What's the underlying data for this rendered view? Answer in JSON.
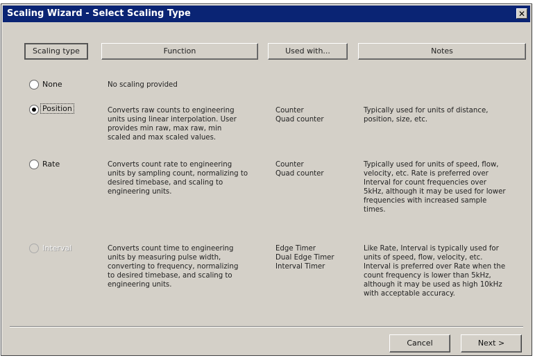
{
  "window": {
    "title": "Scaling Wizard - Select Scaling Type"
  },
  "headers": {
    "scaling_type": "Scaling type",
    "function": "Function",
    "used_with": "Used with...",
    "notes": "Notes"
  },
  "rows": [
    {
      "label": "None",
      "function": "No scaling provided",
      "used_with": "",
      "notes": ""
    },
    {
      "label": "Position",
      "function": "Converts raw counts to engineering\nunits using linear interpolation. User\nprovides min raw, max raw, min\nscaled and max scaled values.",
      "used_with": "Counter\nQuad counter",
      "notes": "Typically used for units of distance,\nposition, size, etc."
    },
    {
      "label": "Rate",
      "function": "Converts count rate to engineering\nunits by sampling count, normalizing to\ndesired timebase, and scaling to\nengineering units.",
      "used_with": "Counter\nQuad counter",
      "notes": "Typically used for units of speed, flow,\nvelocity, etc. Rate is preferred over\nInterval for count frequencies over\n5kHz, although it may be used for lower\nfrequencies with increased sample\ntimes."
    },
    {
      "label": "Interval",
      "function": "Converts count time to engineering\nunits by measuring pulse width,\nconverting to frequency, normalizing\nto desired timebase, and scaling to\nengineering units.",
      "used_with": "Edge Timer\nDual Edge Timer\nInterval Timer",
      "notes": "Like Rate, Interval is typically used for\nunits of speed, flow, velocity, etc.\nInterval is preferred over Rate when the\ncount frequency is lower than 5kHz,\nalthough it may be used as high 10kHz\nwith acceptable accuracy."
    }
  ],
  "buttons": {
    "cancel": "Cancel",
    "next": "Next >"
  }
}
